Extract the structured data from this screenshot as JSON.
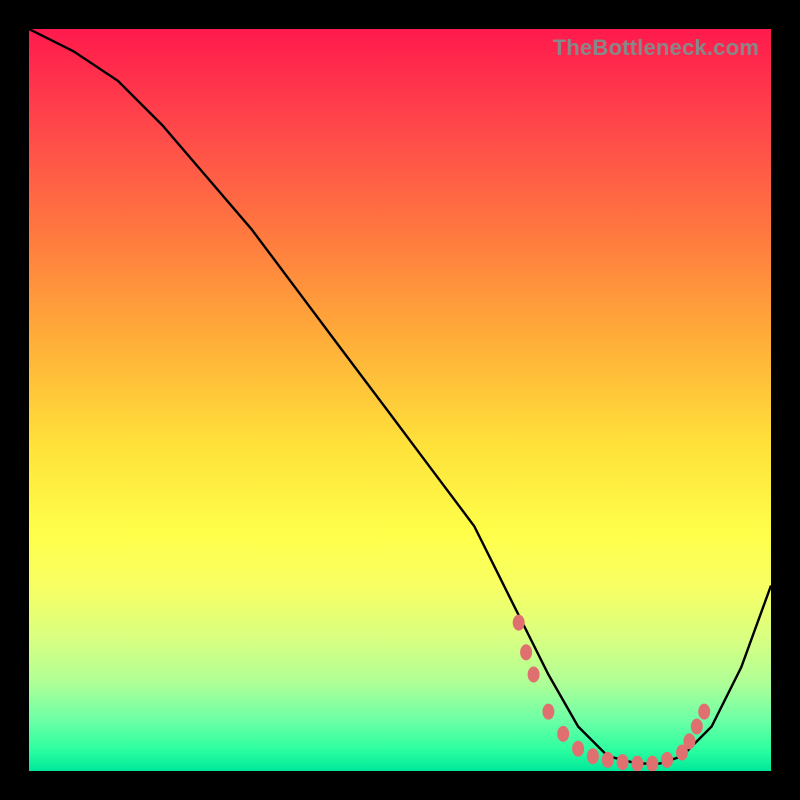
{
  "watermark": "TheBottleneck.com",
  "chart_data": {
    "type": "line",
    "title": "",
    "xlabel": "",
    "ylabel": "",
    "xlim": [
      0,
      100
    ],
    "ylim": [
      0,
      100
    ],
    "grid": false,
    "legend": false,
    "series": [
      {
        "name": "bottleneck-curve",
        "color": "#000000",
        "x": [
          0,
          6,
          12,
          18,
          24,
          30,
          36,
          42,
          48,
          54,
          60,
          63,
          66,
          70,
          74,
          78,
          82,
          85,
          88,
          92,
          96,
          100
        ],
        "y": [
          100,
          97,
          93,
          87,
          80,
          73,
          65,
          57,
          49,
          41,
          33,
          27,
          21,
          13,
          6,
          2,
          1,
          1,
          2,
          6,
          14,
          25
        ]
      }
    ],
    "markers": [
      {
        "name": "marker",
        "color": "#e07070",
        "x": 66,
        "y": 20
      },
      {
        "name": "marker",
        "color": "#e07070",
        "x": 67,
        "y": 16
      },
      {
        "name": "marker",
        "color": "#e07070",
        "x": 68,
        "y": 13
      },
      {
        "name": "marker",
        "color": "#e07070",
        "x": 70,
        "y": 8
      },
      {
        "name": "marker",
        "color": "#e07070",
        "x": 72,
        "y": 5
      },
      {
        "name": "marker",
        "color": "#e07070",
        "x": 74,
        "y": 3
      },
      {
        "name": "marker",
        "color": "#e07070",
        "x": 76,
        "y": 2
      },
      {
        "name": "marker",
        "color": "#e07070",
        "x": 78,
        "y": 1.5
      },
      {
        "name": "marker",
        "color": "#e07070",
        "x": 80,
        "y": 1.2
      },
      {
        "name": "marker",
        "color": "#e07070",
        "x": 82,
        "y": 1
      },
      {
        "name": "marker",
        "color": "#e07070",
        "x": 84,
        "y": 1
      },
      {
        "name": "marker",
        "color": "#e07070",
        "x": 86,
        "y": 1.5
      },
      {
        "name": "marker",
        "color": "#e07070",
        "x": 88,
        "y": 2.5
      },
      {
        "name": "marker",
        "color": "#e07070",
        "x": 89,
        "y": 4
      },
      {
        "name": "marker",
        "color": "#e07070",
        "x": 90,
        "y": 6
      },
      {
        "name": "marker",
        "color": "#e07070",
        "x": 91,
        "y": 8
      }
    ],
    "background_band": {
      "top_color": "#ff1a4d",
      "bottom_color": "#00e89a"
    }
  }
}
